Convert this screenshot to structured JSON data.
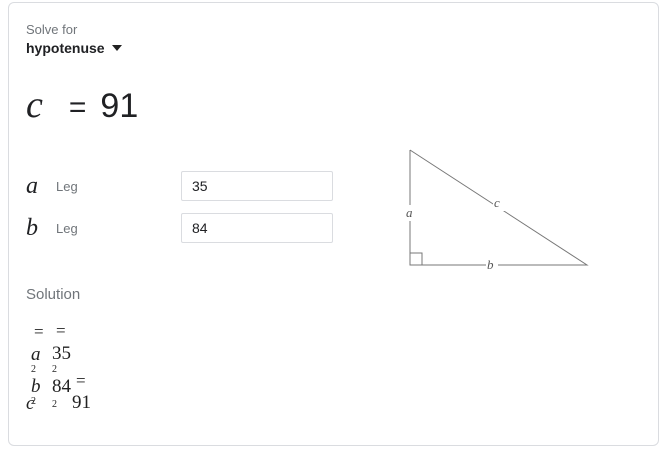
{
  "solve_for": {
    "label": "Solve for",
    "selected": "hypotenuse"
  },
  "result": {
    "variable": "c",
    "equals": "=",
    "value": "91"
  },
  "inputs": [
    {
      "variable": "a",
      "label": "Leg",
      "value": "35"
    },
    {
      "variable": "b",
      "label": "Leg",
      "value": "84"
    }
  ],
  "diagram": {
    "label_a": "a",
    "label_b": "b",
    "label_c": "c"
  },
  "solution": {
    "title": "Solution",
    "eq1": "=",
    "eq2": "=",
    "eq3": "=",
    "a": "a",
    "b": "b",
    "c": "c",
    "exp": "2",
    "v35": "35",
    "v84": "84",
    "v91": "91"
  }
}
